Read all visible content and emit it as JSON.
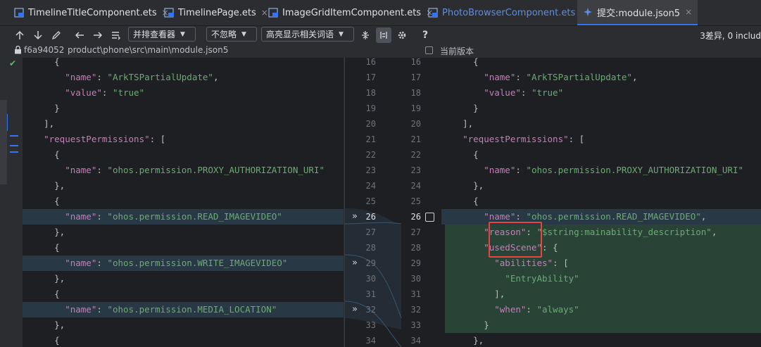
{
  "tabs": [
    {
      "label": "TimelineTitleComponent.ets",
      "close": "×"
    },
    {
      "label": "TimelinePage.ets",
      "close": "×"
    },
    {
      "label": "ImageGridItemComponent.ets",
      "close": "×"
    },
    {
      "label": "PhotoBrowserComponent.ets",
      "close": "×"
    },
    {
      "label": "提交:module.json5",
      "close": "×"
    }
  ],
  "toolbar": {
    "viewer_mode": "并排查看器",
    "whitespace_mode": "不忽略",
    "highlight_mode": "高亮显示相关词语",
    "diff_count": "3差异, 0 includ"
  },
  "path": {
    "commit": "f6a94052",
    "file": "product\\phone\\src\\main\\module.json5",
    "current_version_label": "当前版本"
  },
  "left_lines": [
    {
      "n": "16",
      "tokens": [
        [
          "p",
          "      {"
        ]
      ]
    },
    {
      "n": "17",
      "tokens": [
        [
          "k",
          "        \"name\""
        ],
        [
          "p",
          ": "
        ],
        [
          "s",
          "\"ArkTSPartialUpdate\""
        ],
        [
          "p",
          ","
        ]
      ]
    },
    {
      "n": "18",
      "tokens": [
        [
          "k",
          "        \"value\""
        ],
        [
          "p",
          ": "
        ],
        [
          "s",
          "\"true\""
        ]
      ]
    },
    {
      "n": "19",
      "tokens": [
        [
          "p",
          "      }"
        ]
      ]
    },
    {
      "n": "20",
      "tokens": [
        [
          "p",
          "    ],"
        ]
      ]
    },
    {
      "n": "21",
      "tokens": [
        [
          "k",
          "    \"requestPermissions\""
        ],
        [
          "p",
          ": ["
        ]
      ]
    },
    {
      "n": "22",
      "tokens": [
        [
          "p",
          "      {"
        ]
      ]
    },
    {
      "n": "23",
      "tokens": [
        [
          "k",
          "        \"name\""
        ],
        [
          "p",
          ": "
        ],
        [
          "s",
          "\"ohos.permission.PROXY_AUTHORIZATION_URI\""
        ]
      ]
    },
    {
      "n": "24",
      "tokens": [
        [
          "p",
          "      },"
        ]
      ]
    },
    {
      "n": "25",
      "tokens": [
        [
          "p",
          "      {"
        ]
      ]
    },
    {
      "n": "26",
      "tokens": [
        [
          "k",
          "        \"name\""
        ],
        [
          "p",
          ": "
        ],
        [
          "s",
          "\"ohos.permission.READ_IMAGEVIDEO\""
        ]
      ]
    },
    {
      "n": "27",
      "tokens": [
        [
          "p",
          "      },"
        ]
      ]
    },
    {
      "n": "28",
      "tokens": [
        [
          "p",
          "      {"
        ]
      ]
    },
    {
      "n": "29",
      "tokens": [
        [
          "k",
          "        \"name\""
        ],
        [
          "p",
          ": "
        ],
        [
          "s",
          "\"ohos.permission.WRITE_IMAGEVIDEO\""
        ]
      ]
    },
    {
      "n": "30",
      "tokens": [
        [
          "p",
          "      },"
        ]
      ]
    },
    {
      "n": "31",
      "tokens": [
        [
          "p",
          "      {"
        ]
      ]
    },
    {
      "n": "32",
      "tokens": [
        [
          "k",
          "        \"name\""
        ],
        [
          "p",
          ": "
        ],
        [
          "s",
          "\"ohos.permission.MEDIA_LOCATION\""
        ]
      ]
    },
    {
      "n": "33",
      "tokens": [
        [
          "p",
          "      },"
        ]
      ]
    },
    {
      "n": "34",
      "tokens": [
        [
          "p",
          "      {"
        ]
      ]
    }
  ],
  "right_lines": [
    {
      "n": "16",
      "tokens": [
        [
          "p",
          "      {"
        ]
      ]
    },
    {
      "n": "17",
      "tokens": [
        [
          "k",
          "        \"name\""
        ],
        [
          "p",
          ": "
        ],
        [
          "s",
          "\"ArkTSPartialUpdate\""
        ],
        [
          "p",
          ","
        ]
      ]
    },
    {
      "n": "18",
      "tokens": [
        [
          "k",
          "        \"value\""
        ],
        [
          "p",
          ": "
        ],
        [
          "s",
          "\"true\""
        ]
      ]
    },
    {
      "n": "19",
      "tokens": [
        [
          "p",
          "      }"
        ]
      ]
    },
    {
      "n": "20",
      "tokens": [
        [
          "p",
          "    ],"
        ]
      ]
    },
    {
      "n": "21",
      "tokens": [
        [
          "k",
          "    \"requestPermissions\""
        ],
        [
          "p",
          ": ["
        ]
      ]
    },
    {
      "n": "22",
      "tokens": [
        [
          "p",
          "      {"
        ]
      ]
    },
    {
      "n": "23",
      "tokens": [
        [
          "k",
          "        \"name\""
        ],
        [
          "p",
          ": "
        ],
        [
          "s",
          "\"ohos.permission.PROXY_AUTHORIZATION_URI\""
        ]
      ]
    },
    {
      "n": "24",
      "tokens": [
        [
          "p",
          "      },"
        ]
      ]
    },
    {
      "n": "25",
      "tokens": [
        [
          "p",
          "      {"
        ]
      ]
    },
    {
      "n": "26",
      "tokens": [
        [
          "k",
          "        \"name\""
        ],
        [
          "p",
          ": "
        ],
        [
          "s",
          "\"ohos.permission.READ_IMAGEVIDEO\""
        ],
        [
          "p",
          ","
        ]
      ]
    },
    {
      "n": "27",
      "tokens": [
        [
          "k",
          "        \"reason\""
        ],
        [
          "p",
          ": "
        ],
        [
          "s",
          "\"$string:mainability_description\""
        ],
        [
          "p",
          ","
        ]
      ]
    },
    {
      "n": "28",
      "tokens": [
        [
          "k",
          "        \"usedScene\""
        ],
        [
          "p",
          ": {"
        ]
      ]
    },
    {
      "n": "29",
      "tokens": [
        [
          "k",
          "          \"abilities\""
        ],
        [
          "p",
          ": ["
        ]
      ]
    },
    {
      "n": "30",
      "tokens": [
        [
          "s",
          "            \"EntryAbility\""
        ]
      ]
    },
    {
      "n": "31",
      "tokens": [
        [
          "p",
          "          ],"
        ]
      ]
    },
    {
      "n": "32",
      "tokens": [
        [
          "k",
          "          \"when\""
        ],
        [
          "p",
          ": "
        ],
        [
          "s",
          "\"always\""
        ]
      ]
    },
    {
      "n": "33",
      "tokens": [
        [
          "p",
          "        }"
        ]
      ]
    },
    {
      "n": "34",
      "tokens": [
        [
          "p",
          "      },"
        ]
      ]
    }
  ],
  "left_changed_lines": [
    "26",
    "29",
    "32"
  ],
  "right_added_lines": [
    "27",
    "28",
    "29",
    "30",
    "31",
    "32",
    "33"
  ],
  "colors": {
    "editor_bg": "#1e1f22",
    "panel_bg": "#2b2d30",
    "changed_line_bg": "#293845",
    "added_line_bg": "#294436",
    "key_color": "#c77dbb",
    "string_color": "#6aab73",
    "highlight_box": "#e5453d",
    "accent": "#3574f0"
  },
  "icons": [
    "up-arrow-icon",
    "down-arrow-icon",
    "edit-icon",
    "back-arrow-icon",
    "forward-arrow-icon",
    "list-icon",
    "collapse-icon",
    "sync-scroll-icon",
    "gear-icon",
    "help-icon",
    "lock-icon",
    "checkmark-icon",
    "apply-chevron-icon"
  ]
}
